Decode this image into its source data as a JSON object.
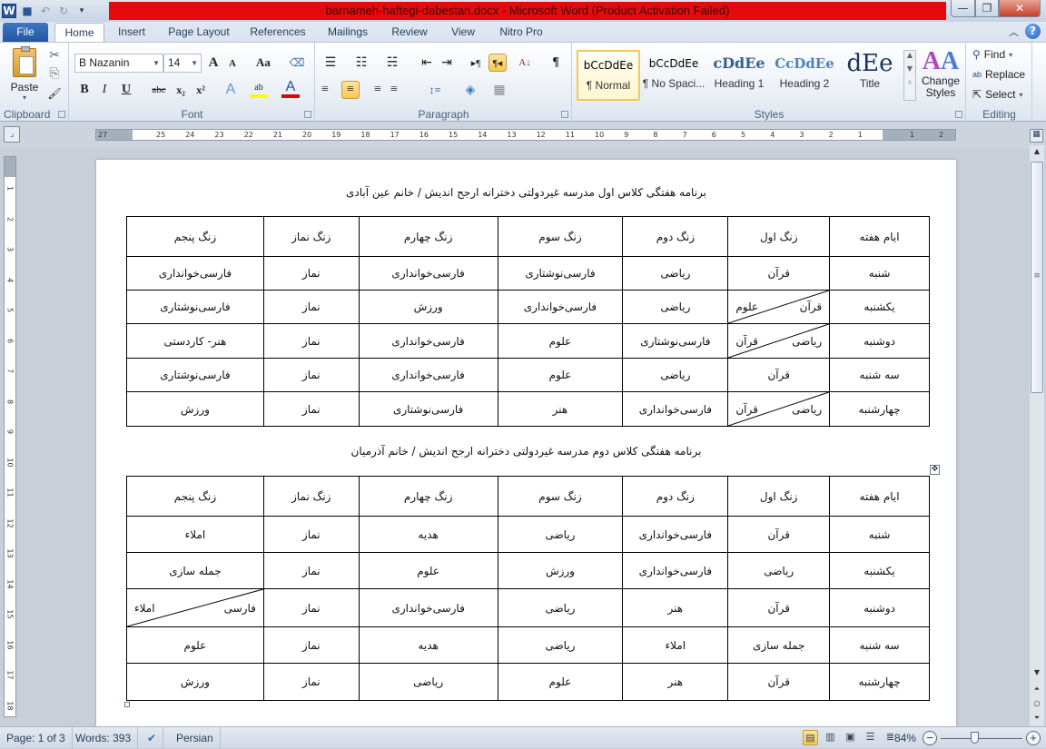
{
  "window": {
    "title": "barnameh-haftegi-dabestan.docx - Microsoft Word (Product Activation Failed)",
    "app_icon": "W",
    "controls": {
      "minimize": "—",
      "maximize": "❐",
      "close": "✕"
    }
  },
  "quick_access": [
    {
      "name": "save-icon",
      "glyph": "💾"
    },
    {
      "name": "undo-icon",
      "glyph": "↶"
    },
    {
      "name": "redo-icon",
      "glyph": "↻"
    },
    {
      "name": "customize-qat-icon",
      "glyph": "▾"
    }
  ],
  "tabs": [
    {
      "label": "File"
    },
    {
      "label": "Home",
      "active": true
    },
    {
      "label": "Insert"
    },
    {
      "label": "Page Layout"
    },
    {
      "label": "References"
    },
    {
      "label": "Mailings"
    },
    {
      "label": "Review"
    },
    {
      "label": "View"
    },
    {
      "label": "Nitro Pro"
    }
  ],
  "ribbon": {
    "clipboard": {
      "label": "Clipboard",
      "paste": "Paste",
      "cut": "✂",
      "copy": "⎘",
      "format_painter": "🖌"
    },
    "font": {
      "label": "Font",
      "family": "B Nazanin",
      "size": "14",
      "grow": "A",
      "shrink": "A",
      "change_case": "Aa",
      "clear_format": "⌫",
      "bold": "B",
      "italic": "I",
      "underline": "U",
      "strike": "abc",
      "subscript": "x₂",
      "superscript": "x²",
      "text_effects": "A",
      "highlight": "ab",
      "font_color": "A",
      "highlight_color": "#ffff00",
      "font_color_value": "#e00000"
    },
    "paragraph": {
      "label": "Paragraph",
      "bullets": "☰",
      "numbering": "☷",
      "multilevel": "☵",
      "decrease_indent": "⇤",
      "increase_indent": "⇥",
      "ltr": "▸¶",
      "rtl": "¶◂",
      "sort": "A↓",
      "show_marks": "¶",
      "align_left": "≡",
      "align_center": "≡",
      "align_right": "≡",
      "justify": "≡",
      "line_spacing": "↕≡",
      "shading": "◈",
      "borders": "▦"
    },
    "styles": {
      "label": "Styles",
      "items": [
        {
          "preview": "bCcDdEe",
          "name": "¶ Normal",
          "selected": true
        },
        {
          "preview": "bCcDdEe",
          "name": "¶ No Spaci..."
        },
        {
          "preview": "cDdEe",
          "name": "Heading 1"
        },
        {
          "preview": "CcDdEe",
          "name": "Heading 2"
        },
        {
          "preview": "dEe",
          "name": "Title"
        }
      ],
      "change_styles": "Change Styles"
    },
    "editing": {
      "label": "Editing",
      "find": "Find",
      "replace": "Replace",
      "select": "Select"
    }
  },
  "ruler": {
    "h_numbers": [
      "27",
      "25",
      "24",
      "23",
      "22",
      "21",
      "20",
      "19",
      "18",
      "17",
      "16",
      "15",
      "14",
      "13",
      "12",
      "11",
      "10",
      "9",
      "8",
      "7",
      "6",
      "5",
      "4",
      "3",
      "2",
      "1",
      "1",
      "2"
    ],
    "v_numbers": [
      "1",
      "2",
      "3",
      "4",
      "5",
      "6",
      "7",
      "8",
      "9",
      "10",
      "11",
      "12",
      "13",
      "14",
      "15",
      "16",
      "17",
      "18"
    ]
  },
  "document": {
    "tables": [
      {
        "title": "برنامه هفتگی کلاس اول مدرسه غیردولتی دخترانه ارجح اندیش / خانم عین آبادی",
        "headers": [
          "ایام هفته",
          "زنگ اول",
          "زنگ دوم",
          "زنگ سوم",
          "زنگ چهارم",
          "زنگ نماز",
          "زنگ پنجم"
        ],
        "rows": [
          [
            {
              "t": "شنبه"
            },
            {
              "t": "قرآن"
            },
            {
              "t": "ریاضی"
            },
            {
              "t": "فارسی‌نوشتاری"
            },
            {
              "t": "فارسی‌خوانداری"
            },
            {
              "t": "نماز"
            },
            {
              "t": "فارسی‌خوانداری"
            }
          ],
          [
            {
              "t": "یکشنبه"
            },
            {
              "split": [
                "قرآن",
                "علوم"
              ]
            },
            {
              "t": "ریاضی"
            },
            {
              "t": "فارسی‌خوانداری"
            },
            {
              "t": "ورزش"
            },
            {
              "t": "نماز"
            },
            {
              "t": "فارسی‌نوشتاری"
            }
          ],
          [
            {
              "t": "دوشنبه"
            },
            {
              "split": [
                "ریاضی",
                "قرآن"
              ]
            },
            {
              "t": "فارسی‌نوشتاری"
            },
            {
              "t": "علوم"
            },
            {
              "t": "فارسی‌خوانداری"
            },
            {
              "t": "نماز"
            },
            {
              "t": "هنر- کاردستی"
            }
          ],
          [
            {
              "t": "سه شنبه"
            },
            {
              "t": "قرآن"
            },
            {
              "t": "ریاضی"
            },
            {
              "t": "علوم"
            },
            {
              "t": "فارسی‌خوانداری"
            },
            {
              "t": "نماز"
            },
            {
              "t": "فارسی‌نوشتاری"
            }
          ],
          [
            {
              "t": "چهارشنبه"
            },
            {
              "split": [
                "ریاضی",
                "قرآن"
              ]
            },
            {
              "t": "فارسی‌خوانداری"
            },
            {
              "t": "هنر"
            },
            {
              "t": "فارسی‌نوشتاری"
            },
            {
              "t": "نماز"
            },
            {
              "t": "ورزش"
            }
          ]
        ]
      },
      {
        "title": "برنامه هفتگی کلاس دوم مدرسه غیردولتی دخترانه ارجح اندیش / خانم آذرمیان",
        "headers": [
          "ایام هفته",
          "زنگ اول",
          "زنگ دوم",
          "زنگ سوم",
          "زنگ چهارم",
          "زنگ نماز",
          "زنگ پنجم"
        ],
        "rows": [
          [
            {
              "t": "شنبه"
            },
            {
              "t": "قرآن"
            },
            {
              "t": "فارسی‌خوانداری"
            },
            {
              "t": "ریاضی"
            },
            {
              "t": "هدیه"
            },
            {
              "t": "نماز"
            },
            {
              "t": "املاء"
            }
          ],
          [
            {
              "t": "یکشنبه"
            },
            {
              "t": "ریاضی"
            },
            {
              "t": "فارسی‌خوانداری"
            },
            {
              "t": "ورزش"
            },
            {
              "t": "علوم"
            },
            {
              "t": "نماز"
            },
            {
              "t": "جمله سازی"
            }
          ],
          [
            {
              "t": "دوشنبه"
            },
            {
              "t": "قرآن"
            },
            {
              "t": "هنر"
            },
            {
              "t": "ریاضی"
            },
            {
              "t": "فارسی‌خوانداری"
            },
            {
              "t": "نماز"
            },
            {
              "split": [
                "فارسی",
                "املاء"
              ]
            }
          ],
          [
            {
              "t": "سه شنبه"
            },
            {
              "t": "جمله سازی"
            },
            {
              "t": "املاء"
            },
            {
              "t": "ریاضی"
            },
            {
              "t": "هدیه"
            },
            {
              "t": "نماز"
            },
            {
              "t": "علوم"
            }
          ],
          [
            {
              "t": "چهارشنبه"
            },
            {
              "t": "قرآن"
            },
            {
              "t": "هنر"
            },
            {
              "t": "علوم"
            },
            {
              "t": "ریاضی"
            },
            {
              "t": "نماز"
            },
            {
              "t": "ورزش"
            }
          ]
        ]
      }
    ]
  },
  "statusbar": {
    "page": "Page: 1 of 3",
    "words": "Words: 393",
    "language": "Persian",
    "zoom": "84%",
    "zoom_level_percent": 84,
    "views": [
      "Print Layout",
      "Full Screen Reading",
      "Web Layout",
      "Outline",
      "Draft"
    ]
  }
}
